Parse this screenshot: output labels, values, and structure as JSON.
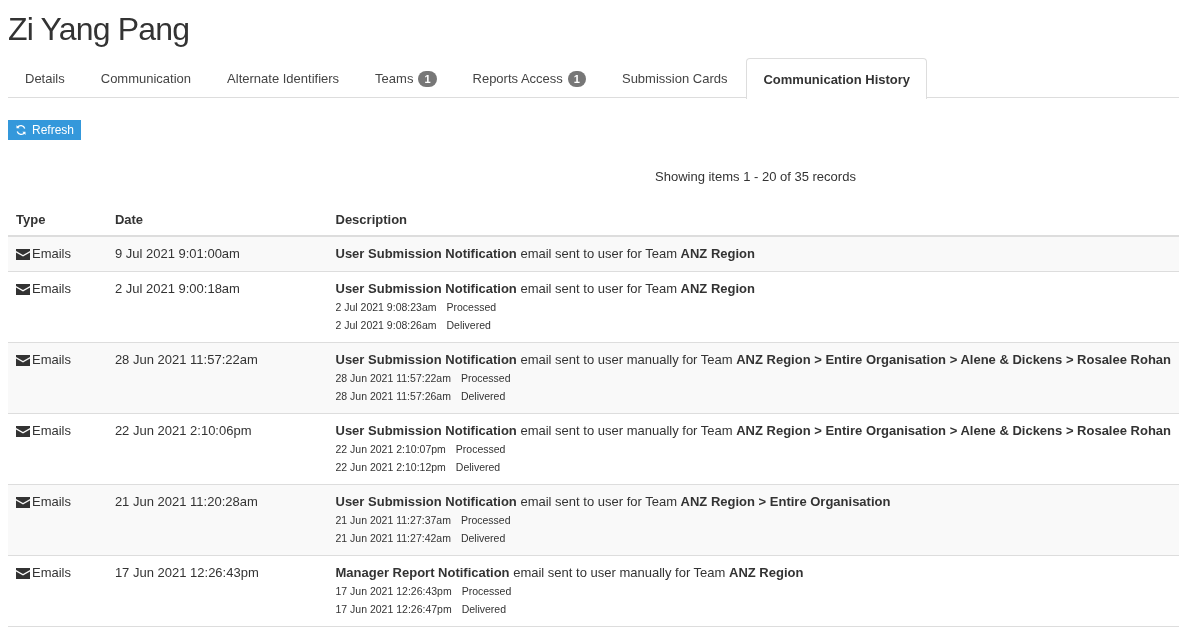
{
  "title": "Zi Yang Pang",
  "tabs": [
    {
      "label": "Details",
      "selected": false
    },
    {
      "label": "Communication",
      "selected": false
    },
    {
      "label": "Alternate Identifiers",
      "selected": false
    },
    {
      "label": "Teams",
      "badge": "1",
      "selected": false
    },
    {
      "label": "Reports Access",
      "badge": "1",
      "selected": false
    },
    {
      "label": "Submission Cards",
      "selected": false
    },
    {
      "label": "Communication History",
      "selected": true
    }
  ],
  "refresh_button": "Refresh",
  "pager_info": "Showing items 1 - 20 of 35 records",
  "table": {
    "columns": [
      "Type",
      "Date",
      "Description"
    ],
    "rows": [
      {
        "type": "Emails",
        "date": "9 Jul 2021 9:01:00am",
        "description": "**User Submission Notification** email sent to user for Team **ANZ Region**",
        "events": []
      },
      {
        "type": "Emails",
        "date": "2 Jul 2021 9:00:18am",
        "description": "**User Submission Notification** email sent to user for Team **ANZ Region**",
        "events": [
          {
            "time": "2 Jul 2021 9:08:23am",
            "status": "Processed"
          },
          {
            "time": "2 Jul 2021 9:08:26am",
            "status": "Delivered"
          }
        ]
      },
      {
        "type": "Emails",
        "date": "28 Jun 2021 11:57:22am",
        "description": "**User Submission Notification** email sent to user manually for Team **ANZ Region > Entire Organisation > Alene & Dickens > Rosalee Rohan**",
        "events": [
          {
            "time": "28 Jun 2021 11:57:22am",
            "status": "Processed"
          },
          {
            "time": "28 Jun 2021 11:57:26am",
            "status": "Delivered"
          }
        ]
      },
      {
        "type": "Emails",
        "date": "22 Jun 2021 2:10:06pm",
        "description": "**User Submission Notification** email sent to user manually for Team **ANZ Region > Entire Organisation > Alene & Dickens > Rosalee Rohan**",
        "events": [
          {
            "time": "22 Jun 2021 2:10:07pm",
            "status": "Processed"
          },
          {
            "time": "22 Jun 2021 2:10:12pm",
            "status": "Delivered"
          }
        ]
      },
      {
        "type": "Emails",
        "date": "21 Jun 2021 11:20:28am",
        "description": "**User Submission Notification** email sent to user for Team **ANZ Region > Entire Organisation**",
        "events": [
          {
            "time": "21 Jun 2021 11:27:37am",
            "status": "Processed"
          },
          {
            "time": "21 Jun 2021 11:27:42am",
            "status": "Delivered"
          }
        ]
      },
      {
        "type": "Emails",
        "date": "17 Jun 2021 12:26:43pm",
        "description": "**Manager Report Notification** email sent to user manually for Team **ANZ Region**",
        "events": [
          {
            "time": "17 Jun 2021 12:26:43pm",
            "status": "Processed"
          },
          {
            "time": "17 Jun 2021 12:26:47pm",
            "status": "Delivered"
          }
        ]
      }
    ]
  }
}
